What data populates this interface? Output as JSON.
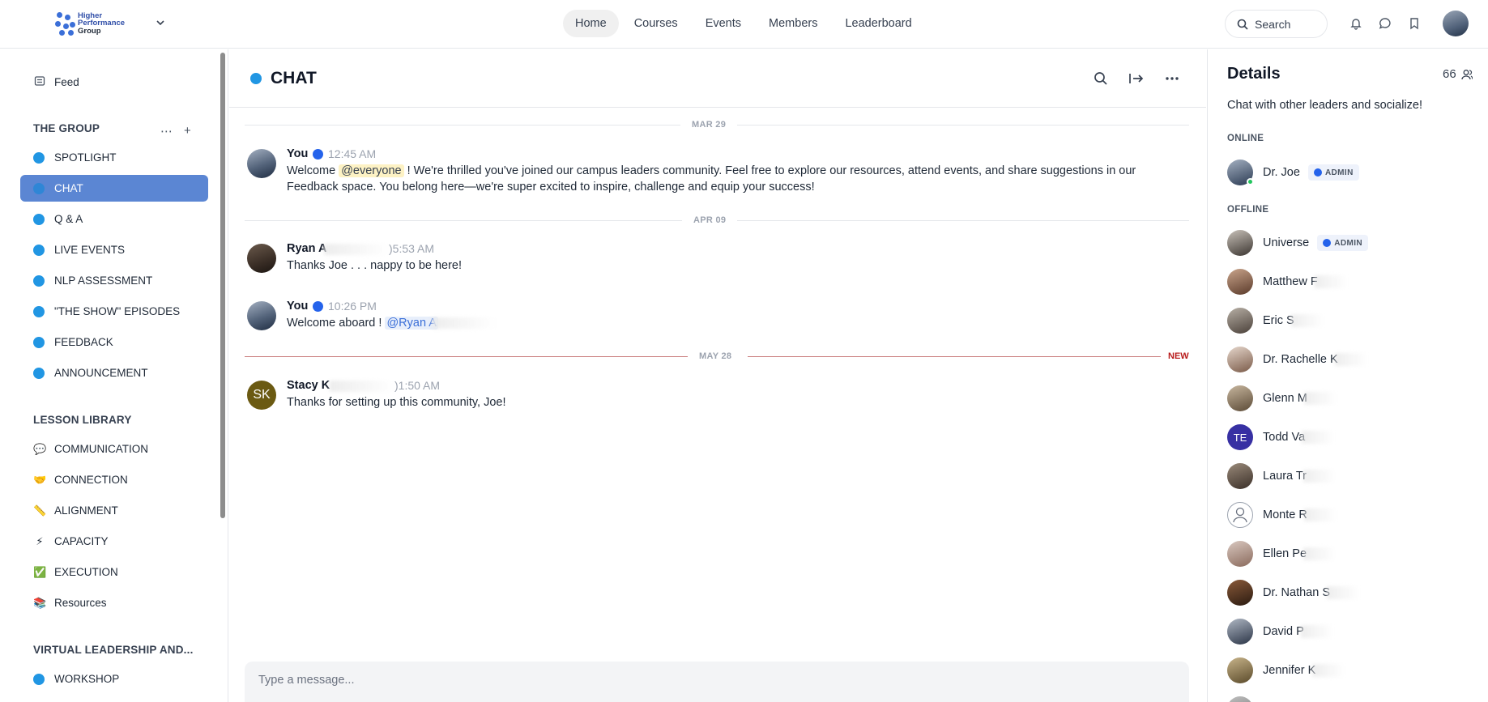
{
  "brand": {
    "logo_line1": "Higher",
    "logo_line2": "Performance",
    "logo_line3": "Group"
  },
  "nav": {
    "items": [
      {
        "label": "Home",
        "active": true
      },
      {
        "label": "Courses",
        "active": false
      },
      {
        "label": "Events",
        "active": false
      },
      {
        "label": "Members",
        "active": false
      },
      {
        "label": "Leaderboard",
        "active": false
      }
    ],
    "search_label": "Search"
  },
  "sidebar": {
    "feed_label": "Feed",
    "group_heading": "THE GROUP",
    "group_items": [
      {
        "label": "SPOTLIGHT"
      },
      {
        "label": "CHAT",
        "active": true
      },
      {
        "label": "Q & A"
      },
      {
        "label": "LIVE EVENTS"
      },
      {
        "label": "NLP ASSESSMENT"
      },
      {
        "label": "\"THE SHOW\" EPISODES"
      },
      {
        "label": "FEEDBACK"
      },
      {
        "label": "ANNOUNCEMENT"
      }
    ],
    "library_heading": "LESSON LIBRARY",
    "library_items": [
      {
        "emoji": "💬",
        "label": "COMMUNICATION"
      },
      {
        "emoji": "🤝",
        "label": "CONNECTION"
      },
      {
        "emoji": "📏",
        "label": "ALIGNMENT"
      },
      {
        "emoji": "⚡",
        "label": "CAPACITY"
      },
      {
        "emoji": "✅",
        "label": "EXECUTION"
      },
      {
        "emoji": "📚",
        "label": "Resources"
      }
    ],
    "virtual_heading": "VIRTUAL LEADERSHIP AND...",
    "virtual_items": [
      {
        "label": "WORKSHOP"
      }
    ]
  },
  "chat": {
    "title": "CHAT",
    "dates": [
      "MAR 29",
      "APR 09",
      "MAY 28"
    ],
    "new_label": "NEW",
    "messages": [
      {
        "author": "You",
        "time": "12:45 AM",
        "text_before": "Welcome ",
        "mention": "@everyone",
        "text_after": " ! We're thrilled you've joined our campus leaders community. Feel free to explore our resources, attend events, and share suggestions in our Feedback space. You belong here—we're super excited to inspire, challenge and equip your success!"
      },
      {
        "author": "Ryan A",
        "time": ")5:53 AM",
        "text": "Thanks Joe . . . nappy to be here!"
      },
      {
        "author": "You",
        "time": "10:26 PM",
        "text_before": "Welcome aboard ! ",
        "mention": "@Ryan A"
      },
      {
        "author": "Stacy K",
        "initials": "SK",
        "time": ")1:50 AM",
        "text": "Thanks for setting up this community, Joe!"
      }
    ],
    "composer_placeholder": "Type a message..."
  },
  "details": {
    "title": "Details",
    "member_count": "66",
    "description": "Chat with other leaders and socialize!",
    "online_heading": "ONLINE",
    "offline_heading": "OFFLINE",
    "admin_label": "ADMIN",
    "online": [
      {
        "name": "Dr. Joe",
        "admin": true
      }
    ],
    "offline": [
      {
        "name": "Universe",
        "admin": true
      },
      {
        "name": "Matthew F"
      },
      {
        "name": "Eric S"
      },
      {
        "name": "Dr. Rachelle K"
      },
      {
        "name": "Glenn M"
      },
      {
        "name": "Todd Va",
        "initials": "TE"
      },
      {
        "name": "Laura Tr"
      },
      {
        "name": "Monte R"
      },
      {
        "name": "Ellen Pe"
      },
      {
        "name": "Dr. Nathan S"
      },
      {
        "name": "David P"
      },
      {
        "name": "Jennifer K"
      }
    ]
  },
  "colors": {
    "accent": "#5b86d3",
    "channel_dot": "#2196e3",
    "new_divider": "#c97b7b",
    "online": "#22c55e"
  }
}
